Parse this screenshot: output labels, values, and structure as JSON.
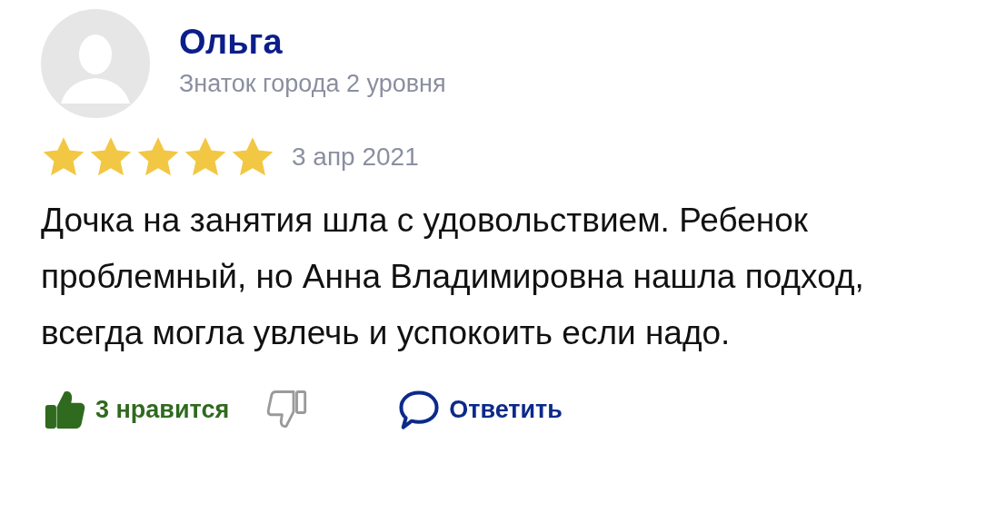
{
  "review": {
    "author": "Ольга",
    "author_level": "Знаток города 2 уровня",
    "stars": 5,
    "date": "3 апр 2021",
    "text": "Дочка на занятия шла с удовольствием. Ребенок проблемный, но Анна Владимировна нашла подход, всегда могла увлечь и успокоить если надо."
  },
  "actions": {
    "like": {
      "label": "3 нравится",
      "selected": true
    },
    "dislike": {
      "selected": false
    },
    "reply": {
      "label": "Ответить"
    }
  }
}
